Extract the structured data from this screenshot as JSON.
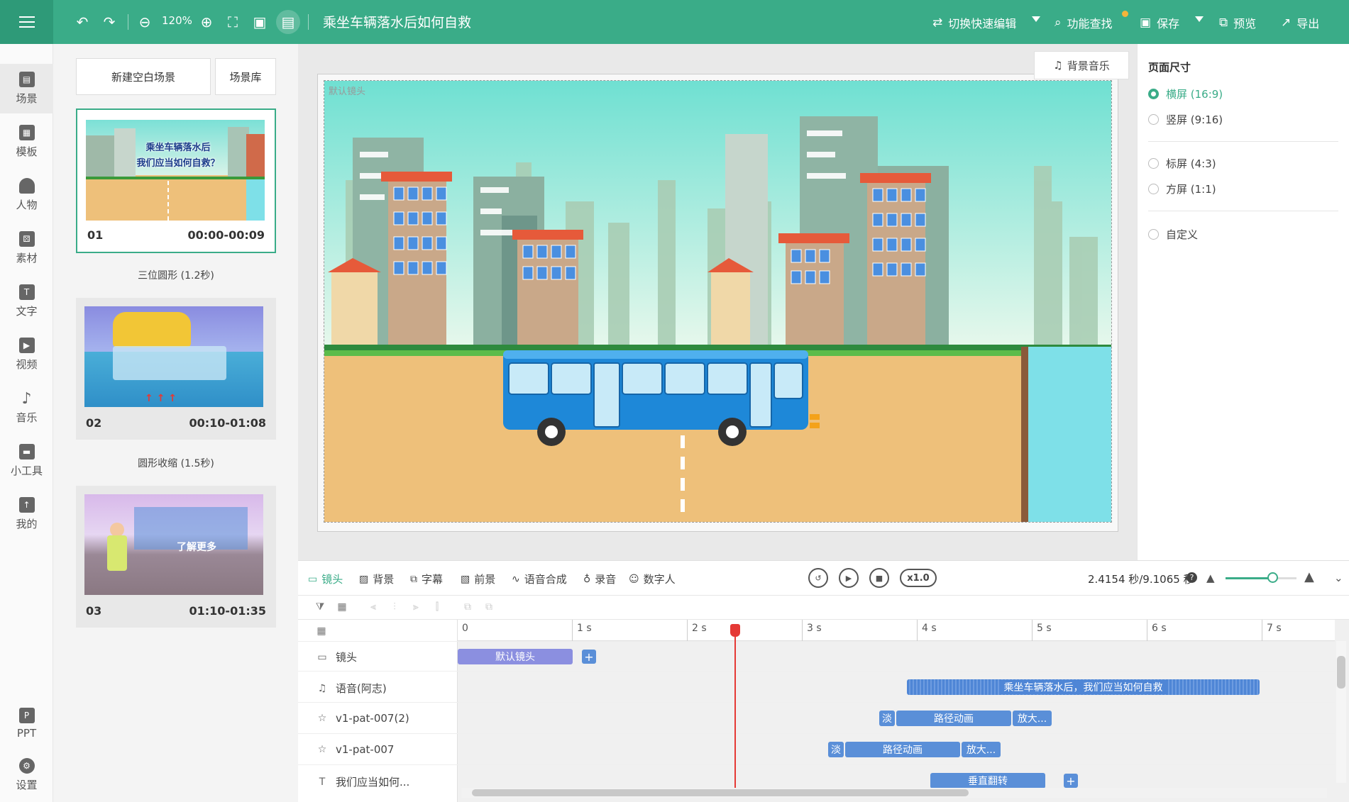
{
  "app": {
    "doc_title": "乘坐车辆落水后如何自救",
    "zoom": "120%"
  },
  "toolbar": {
    "switch_edit": "切换快速编辑",
    "find": "功能查找",
    "save": "保存",
    "preview": "预览",
    "export": "导出"
  },
  "sidebar": {
    "items": [
      {
        "label": "场景",
        "icon": "scene-icon"
      },
      {
        "label": "模板",
        "icon": "template-icon"
      },
      {
        "label": "人物",
        "icon": "person-icon"
      },
      {
        "label": "素材",
        "icon": "material-icon"
      },
      {
        "label": "文字",
        "icon": "text-icon"
      },
      {
        "label": "视频",
        "icon": "video-icon"
      },
      {
        "label": "音乐",
        "icon": "music-icon"
      },
      {
        "label": "小工具",
        "icon": "toolbox-icon"
      },
      {
        "label": "我的",
        "icon": "upload-icon"
      },
      {
        "label": "PPT",
        "icon": "ppt-icon"
      },
      {
        "label": "设置",
        "icon": "settings-icon"
      }
    ]
  },
  "scenes": {
    "new_blank": "新建空白场景",
    "library": "场景库",
    "items": [
      {
        "num": "01",
        "time": "00:00-00:09",
        "thumb_title_1": "乘坐车辆落水后",
        "thumb_title_2": "我们应当如何自救？"
      },
      {
        "num": "02",
        "time": "00:10-01:08"
      },
      {
        "num": "03",
        "time": "01:10-01:35",
        "thumb_title": "了解更多"
      }
    ],
    "transitions": [
      "三位圆形 (1.2秒)",
      "圆形收缩 (1.5秒)"
    ]
  },
  "canvas": {
    "bgm_button": "背景音乐",
    "camera_label": "默认镜头"
  },
  "page_size": {
    "title": "页面尺寸",
    "options": [
      {
        "label": "横屏 (16:9)",
        "selected": true
      },
      {
        "label": "竖屏 (9:16)",
        "selected": false
      },
      {
        "label": "标屏 (4:3)",
        "selected": false
      },
      {
        "label": "方屏 (1:1)",
        "selected": false
      },
      {
        "label": "自定义",
        "selected": false
      }
    ]
  },
  "timeline": {
    "tabs": [
      {
        "label": "镜头",
        "icon": "camera-icon"
      },
      {
        "label": "背景",
        "icon": "background-icon"
      },
      {
        "label": "字幕",
        "icon": "subtitle-icon"
      },
      {
        "label": "前景",
        "icon": "foreground-icon"
      },
      {
        "label": "语音合成",
        "icon": "tts-icon"
      },
      {
        "label": "录音",
        "icon": "mic-icon"
      },
      {
        "label": "数字人",
        "icon": "digital-human-icon"
      }
    ],
    "speed": "x1.0",
    "time_readout": "2.4154 秒/9.1065 秒",
    "ruler": [
      "0",
      "1 s",
      "2 s",
      "3 s",
      "4 s",
      "5 s",
      "6 s",
      "7 s"
    ],
    "playhead_seconds": 2.4154,
    "tracks": [
      {
        "label": "镜头",
        "icon": "camera-icon"
      },
      {
        "label": "语音(阿志)",
        "icon": "music-note-icon"
      },
      {
        "label": "v1-pat-007(2)",
        "icon": "star-icon"
      },
      {
        "label": "v1-pat-007",
        "icon": "star-icon"
      },
      {
        "label": "我们应当如何...",
        "icon": "text-icon"
      }
    ],
    "clips": {
      "camera": "默认镜头",
      "voice": "乘坐车辆落水后，我们应当如何自救",
      "fade": "淡",
      "path_anim": "路径动画",
      "zoom": "放大...",
      "flip": "垂直翻转"
    }
  },
  "colors": {
    "accent": "#3aac88",
    "sky_top": "#6fe0d2",
    "ground": "#eec07a",
    "water": "#7ee0e8",
    "bus": "#1e88d8"
  }
}
